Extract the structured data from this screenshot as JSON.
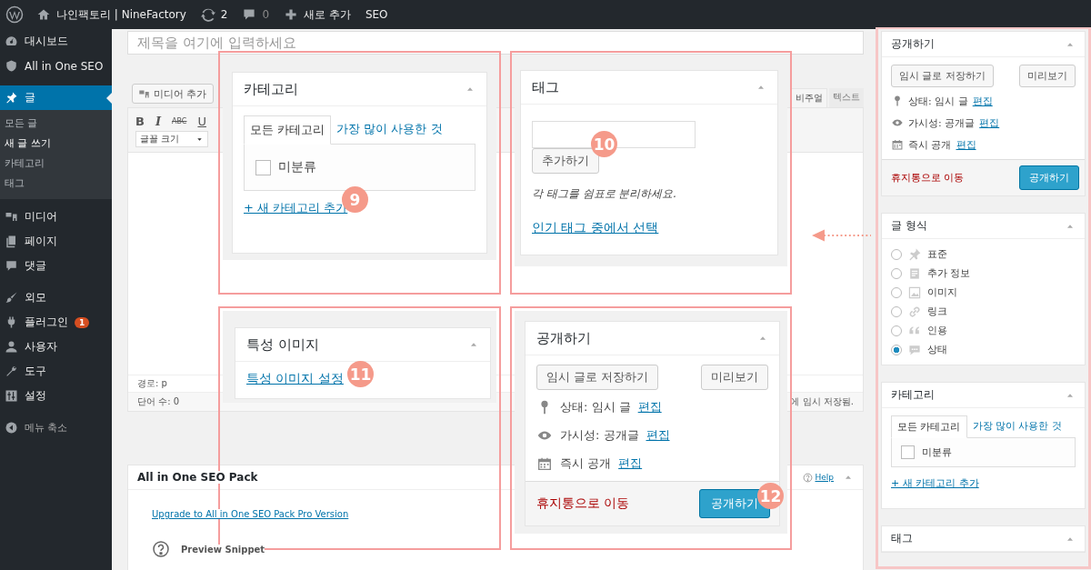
{
  "admin_bar": {
    "site_name": "나인팩토리 | NineFactory",
    "updates": "2",
    "comments": "0",
    "new_label": "새로 추가",
    "seo": "SEO"
  },
  "sidebar": {
    "groups": [
      [
        {
          "label": "대시보드",
          "selected": false
        },
        {
          "label": "All in One SEO",
          "selected": false
        }
      ],
      [
        {
          "label": "글",
          "selected": true,
          "children": [
            {
              "label": "모든 글",
              "selected": false
            },
            {
              "label": "새 글 쓰기",
              "selected": true
            },
            {
              "label": "카테고리",
              "selected": false
            },
            {
              "label": "태그",
              "selected": false
            }
          ]
        },
        {
          "label": "미디어",
          "selected": false
        },
        {
          "label": "페이지",
          "selected": false
        },
        {
          "label": "댓글",
          "selected": false
        }
      ],
      [
        {
          "label": "외모",
          "selected": false
        },
        {
          "label": "플러그인",
          "selected": false,
          "badge": "1"
        },
        {
          "label": "사용자",
          "selected": false
        },
        {
          "label": "도구",
          "selected": false
        },
        {
          "label": "설정",
          "selected": false
        }
      ]
    ],
    "collapse": "메뉴 축소"
  },
  "editor": {
    "title_placeholder": "제목을 여기에 입력하세요",
    "media_button": "미디어 추가",
    "tabs": [
      {
        "label": "비주얼",
        "selected": true
      },
      {
        "label": "텍스트",
        "selected": false
      }
    ],
    "toolbar": [
      {
        "label": "B",
        "kind": "bold"
      },
      {
        "label": "I",
        "kind": "italic"
      },
      {
        "label": "ABC",
        "kind": "strike"
      },
      {
        "label": "U",
        "kind": "underline"
      }
    ],
    "font_size": "글꼴 크기",
    "path": "경로: p",
    "word_count": "단어 수: 0",
    "autosave": "에 임시 저장됨."
  },
  "seo_box": {
    "title": "All in One SEO Pack",
    "help": "Help",
    "upgrade_link": "Upgrade to All in One SEO Pack Pro Version",
    "preview": "Preview Snippet"
  },
  "callouts": [
    {
      "kind": "category",
      "badge": "9",
      "title": "카테고리",
      "tabs": [
        {
          "label": "모든 카테고리",
          "selected": true
        },
        {
          "label": "가장 많이 사용한 것",
          "selected": false
        }
      ],
      "items": [
        {
          "label": "미분류",
          "checked": false
        }
      ],
      "add_link": "+ 새 카테고리 추가"
    },
    {
      "kind": "tags",
      "badge": "10",
      "title": "태그",
      "button": "추가하기",
      "hint": "각 태그를 쉼표로 분리하세요.",
      "link": "인기 태그 중에서 선택"
    },
    {
      "kind": "featured_image",
      "badge": "11",
      "title": "특성 이미지",
      "link": "특성 이미지 설정"
    },
    {
      "kind": "publish",
      "badge": "12",
      "title": "공개하기",
      "save_draft": "임시 글로 저장하기",
      "preview": "미리보기",
      "rows": [
        {
          "kind": "status",
          "label": "상태: 임시 글",
          "link": "편집"
        },
        {
          "kind": "visibility",
          "label": "가시성: 공개글",
          "link": "편집"
        },
        {
          "kind": "schedule",
          "label": "즉시 공개",
          "link": "편집"
        }
      ],
      "trash": "휴지통으로 이동",
      "publish": "공개하기"
    }
  ],
  "right_sidebar": {
    "panels": [
      {
        "kind": "publish",
        "title": "공개하기",
        "save_draft": "임시 글로 저장하기",
        "preview": "미리보기",
        "rows": [
          {
            "kind": "status",
            "label": "상태: 임시 글",
            "link": "편집"
          },
          {
            "kind": "visibility",
            "label": "가시성: 공개글",
            "link": "편집"
          },
          {
            "kind": "schedule",
            "label": "즉시 공개",
            "link": "편집"
          }
        ],
        "trash": "휴지통으로 이동",
        "publish": "공개하기"
      },
      {
        "kind": "post_format",
        "title": "글 형식",
        "options": [
          {
            "label": "표준",
            "selected": false
          },
          {
            "label": "추가 정보",
            "selected": false
          },
          {
            "label": "이미지",
            "selected": false
          },
          {
            "label": "링크",
            "selected": false
          },
          {
            "label": "인용",
            "selected": false
          },
          {
            "label": "상태",
            "selected": true
          }
        ]
      },
      {
        "kind": "category",
        "title": "카테고리",
        "tabs": [
          {
            "label": "모든 카테고리",
            "selected": true
          },
          {
            "label": "가장 많이 사용한 것",
            "selected": false
          }
        ],
        "items": [
          {
            "label": "미분류",
            "checked": false
          }
        ],
        "add_link": "+ 새 카테고리 추가"
      },
      {
        "kind": "tags",
        "title": "태그"
      }
    ]
  }
}
